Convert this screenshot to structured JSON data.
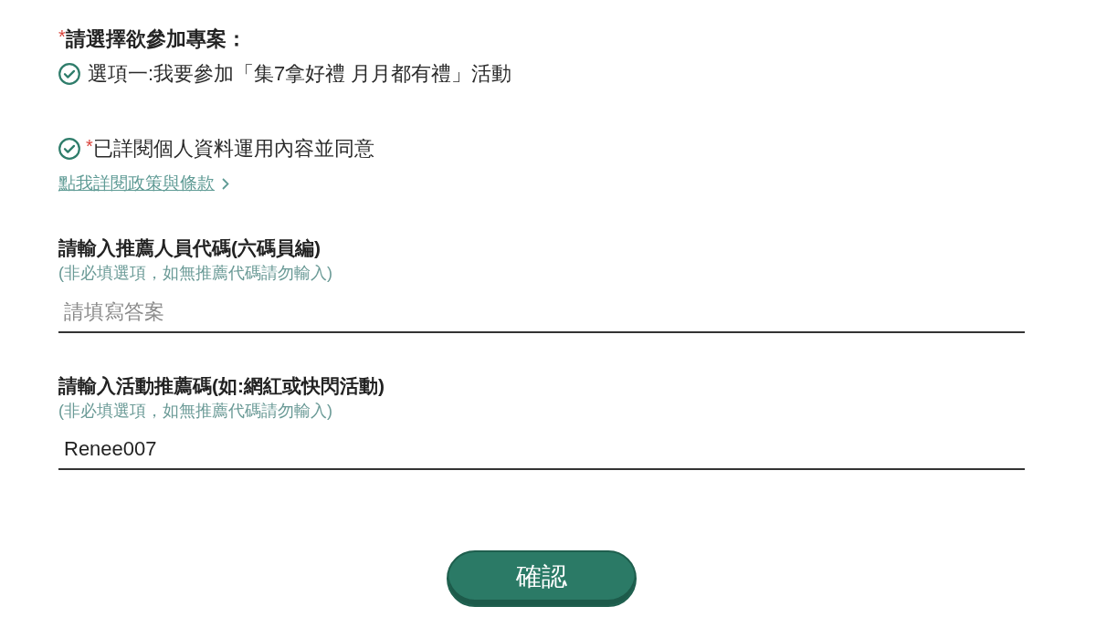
{
  "question": {
    "required_mark": "*",
    "label": "請選擇欲參加專案："
  },
  "options": [
    {
      "label": "選項一:我要參加「集7拿好禮 月月都有禮」活動",
      "checked": true
    }
  ],
  "agreement": {
    "checked": true,
    "required_mark": "*",
    "label": "已詳閱個人資料運用內容並同意"
  },
  "policy_link": {
    "label": "點我詳閱政策與條款"
  },
  "fields": [
    {
      "label": "請輸入推薦人員代碼(六碼員編)",
      "hint": "(非必填選項，如無推薦代碼請勿輸入)",
      "placeholder": "請填寫答案"
    },
    {
      "label": "請輸入活動推薦碼(如:網紅或快閃活動)",
      "hint": "(非必填選項，如無推薦代碼請勿輸入)",
      "value": "Renee007"
    }
  ],
  "submit": {
    "label": "確認"
  }
}
